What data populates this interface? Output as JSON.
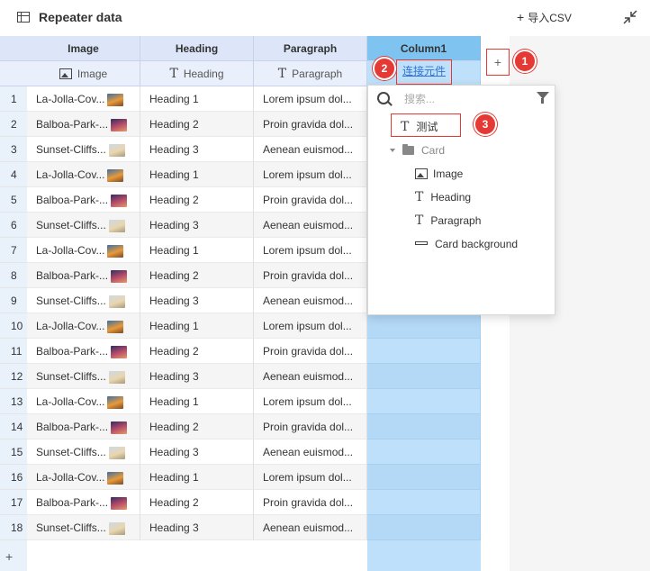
{
  "header": {
    "title": "Repeater data",
    "import_label": "导入CSV",
    "import_plus": "+"
  },
  "columns": [
    {
      "name": "Image",
      "type": "Image",
      "type_icon": "image-icon"
    },
    {
      "name": "Heading",
      "type": "Heading",
      "type_icon": "text-icon"
    },
    {
      "name": "Paragraph",
      "type": "Paragraph",
      "type_icon": "text-icon"
    },
    {
      "name": "Column1",
      "link_label": "连接元件"
    }
  ],
  "add_column_label": "+",
  "add_row_label": "+",
  "rows": [
    {
      "n": "1",
      "image": "La-Jolla-Cov...",
      "heading": "Heading 1",
      "paragraph": "Lorem ipsum dol...",
      "thumb": "t1"
    },
    {
      "n": "2",
      "image": "Balboa-Park-...",
      "heading": "Heading 2",
      "paragraph": "Proin gravida dol...",
      "thumb": "t2"
    },
    {
      "n": "3",
      "image": "Sunset-Cliffs...",
      "heading": "Heading 3",
      "paragraph": "Aenean euismod...",
      "thumb": "t3"
    },
    {
      "n": "4",
      "image": "La-Jolla-Cov...",
      "heading": "Heading 1",
      "paragraph": "Lorem ipsum dol...",
      "thumb": "t1"
    },
    {
      "n": "5",
      "image": "Balboa-Park-...",
      "heading": "Heading 2",
      "paragraph": "Proin gravida dol...",
      "thumb": "t2"
    },
    {
      "n": "6",
      "image": "Sunset-Cliffs...",
      "heading": "Heading 3",
      "paragraph": "Aenean euismod...",
      "thumb": "t3"
    },
    {
      "n": "7",
      "image": "La-Jolla-Cov...",
      "heading": "Heading 1",
      "paragraph": "Lorem ipsum dol...",
      "thumb": "t1"
    },
    {
      "n": "8",
      "image": "Balboa-Park-...",
      "heading": "Heading 2",
      "paragraph": "Proin gravida dol...",
      "thumb": "t2"
    },
    {
      "n": "9",
      "image": "Sunset-Cliffs...",
      "heading": "Heading 3",
      "paragraph": "Aenean euismod...",
      "thumb": "t3"
    },
    {
      "n": "10",
      "image": "La-Jolla-Cov...",
      "heading": "Heading 1",
      "paragraph": "Lorem ipsum dol...",
      "thumb": "t1"
    },
    {
      "n": "11",
      "image": "Balboa-Park-...",
      "heading": "Heading 2",
      "paragraph": "Proin gravida dol...",
      "thumb": "t2"
    },
    {
      "n": "12",
      "image": "Sunset-Cliffs...",
      "heading": "Heading 3",
      "paragraph": "Aenean euismod...",
      "thumb": "t3"
    },
    {
      "n": "13",
      "image": "La-Jolla-Cov...",
      "heading": "Heading 1",
      "paragraph": "Lorem ipsum dol...",
      "thumb": "t1"
    },
    {
      "n": "14",
      "image": "Balboa-Park-...",
      "heading": "Heading 2",
      "paragraph": "Proin gravida dol...",
      "thumb": "t2"
    },
    {
      "n": "15",
      "image": "Sunset-Cliffs...",
      "heading": "Heading 3",
      "paragraph": "Aenean euismod...",
      "thumb": "t3"
    },
    {
      "n": "16",
      "image": "La-Jolla-Cov...",
      "heading": "Heading 1",
      "paragraph": "Lorem ipsum dol...",
      "thumb": "t1"
    },
    {
      "n": "17",
      "image": "Balboa-Park-...",
      "heading": "Heading 2",
      "paragraph": "Proin gravida dol...",
      "thumb": "t2"
    },
    {
      "n": "18",
      "image": "Sunset-Cliffs...",
      "heading": "Heading 3",
      "paragraph": "Aenean euismod...",
      "thumb": "t3"
    }
  ],
  "dropdown": {
    "search_placeholder": "搜索...",
    "items": [
      {
        "label": "测试",
        "icon": "text-icon"
      },
      {
        "label": "Card",
        "icon": "folder-icon"
      },
      {
        "label": "Image",
        "icon": "image-icon"
      },
      {
        "label": "Heading",
        "icon": "text-icon"
      },
      {
        "label": "Paragraph",
        "icon": "text-icon"
      },
      {
        "label": "Card background",
        "icon": "rectangle-icon"
      }
    ]
  },
  "annotations": [
    "1",
    "2",
    "3"
  ],
  "colors": {
    "accent_red": "#e53935",
    "link_blue": "#2f72d8",
    "column_highlight": "#bfe0fa",
    "header_bg": "#dde6f9"
  }
}
